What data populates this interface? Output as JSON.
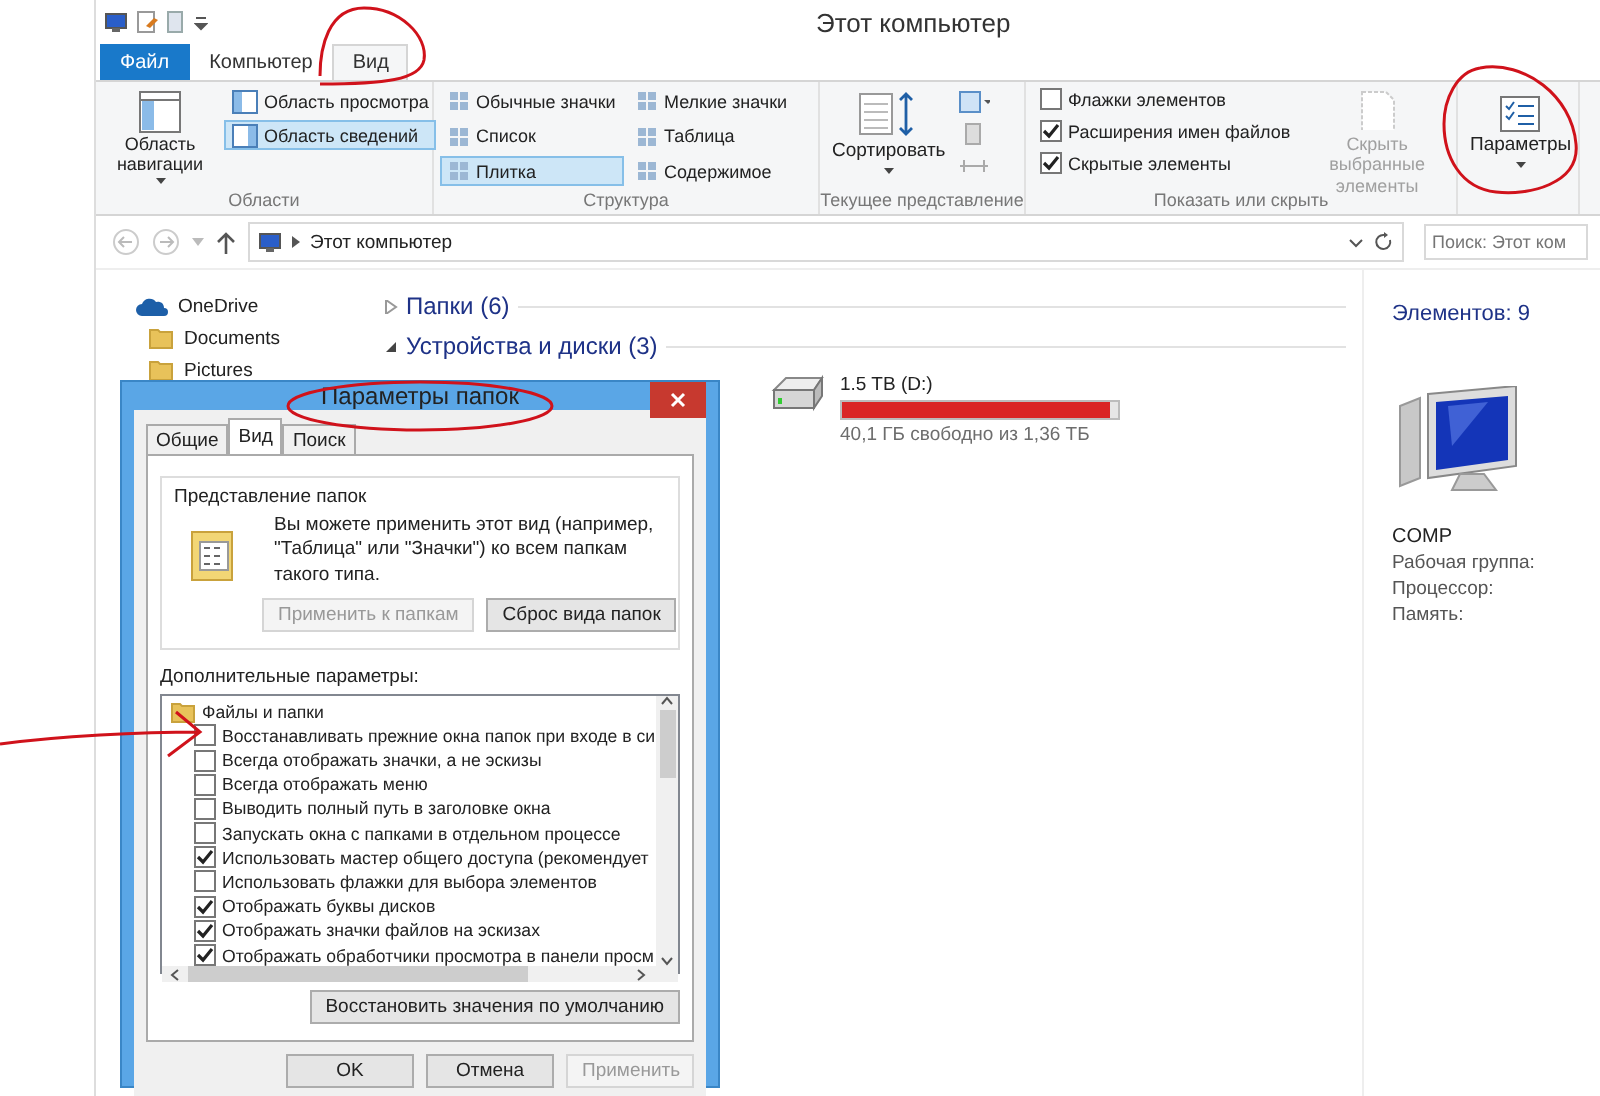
{
  "window": {
    "title": "Этот компьютер"
  },
  "ribbon": {
    "tabs": [
      {
        "label": "Файл",
        "kind": "file",
        "selected": false
      },
      {
        "label": "Компьютер",
        "kind": "tab",
        "selected": false
      },
      {
        "label": "Вид",
        "kind": "tab",
        "selected": true
      }
    ],
    "areas": {
      "label": "Области",
      "nav_pane": "Область навигации",
      "panes": [
        {
          "label": "Область просмотра",
          "selected": false
        },
        {
          "label": "Область сведений",
          "selected": true
        }
      ]
    },
    "layout": {
      "label": "Структура",
      "views": [
        {
          "label": "Обычные значки",
          "selected": false
        },
        {
          "label": "Мелкие значки",
          "selected": false
        },
        {
          "label": "Список",
          "selected": false
        },
        {
          "label": "Таблица",
          "selected": false
        },
        {
          "label": "Плитка",
          "selected": true
        },
        {
          "label": "Содержимое",
          "selected": false
        }
      ]
    },
    "current_view": {
      "label": "Текущее представление",
      "sort": "Сортировать"
    },
    "show_hide": {
      "label": "Показать или скрыть",
      "checkboxes": [
        {
          "label": "Флажки элементов",
          "checked": false
        },
        {
          "label": "Расширения имен файлов",
          "checked": true
        },
        {
          "label": "Скрытые элементы",
          "checked": true
        }
      ],
      "hide_selected": {
        "label": "Скрыть выбранные элементы",
        "disabled": true
      }
    },
    "options": {
      "label": "Параметры"
    }
  },
  "address_bar": {
    "path": "Этот компьютер"
  },
  "search": {
    "placeholder": "Поиск: Этот ком"
  },
  "nav_pane": {
    "items": [
      {
        "label": "OneDrive",
        "kind": "cloud"
      },
      {
        "label": "Documents",
        "kind": "folder"
      },
      {
        "label": "Pictures",
        "kind": "folder"
      }
    ]
  },
  "content": {
    "groups": [
      {
        "label": "Папки (6)",
        "expanded": false
      },
      {
        "label": "Устройства и диски (3)",
        "expanded": true
      }
    ],
    "drives": [
      {
        "name": "1.5 TB (D:)",
        "level": 0.97,
        "free": "40,1 ГБ свободно из 1,36 ТБ"
      }
    ]
  },
  "details": {
    "count": "Элементов: 9",
    "name": "COMP",
    "properties": [
      "Рабочая группа:",
      "Процессор:",
      "Память:"
    ]
  },
  "dialog": {
    "title": "Параметры папок",
    "tabs": [
      {
        "label": "Общие",
        "selected": false
      },
      {
        "label": "Вид",
        "selected": true
      },
      {
        "label": "Поиск",
        "selected": false
      }
    ],
    "folder_views": {
      "legend": "Представление папок",
      "text": "Вы можете применить этот вид (например, \"Таблица\" или \"Значки\") ко всем папкам такого типа.",
      "buttons": [
        {
          "label": "Применить к папкам",
          "disabled": true
        },
        {
          "label": "Сброс вида папок",
          "disabled": false
        }
      ]
    },
    "advanced": {
      "label": "Дополнительные параметры:",
      "tree": [
        {
          "label": "Файлы и папки",
          "children": [
            {
              "label": "Восстанавливать прежние окна папок при входе в си",
              "checked": false
            },
            {
              "label": "Всегда отображать значки, а не эскизы",
              "checked": false
            },
            {
              "label": "Всегда отображать меню",
              "checked": false
            },
            {
              "label": "Выводить полный путь в заголовке окна",
              "checked": false
            },
            {
              "label": "Запускать окна с папками в отдельном процессе",
              "checked": false
            },
            {
              "label": "Использовать мастер общего доступа (рекомендует",
              "checked": true
            },
            {
              "label": "Использовать флажки для выбора элементов",
              "checked": false
            },
            {
              "label": "Отображать буквы дисков",
              "checked": true
            },
            {
              "label": "Отображать значки файлов на эскизах",
              "checked": true
            },
            {
              "label": "Отображать обработчики просмотра в панели просм",
              "checked": true
            }
          ]
        }
      ]
    },
    "restore": "Восстановить значения по умолчанию",
    "buttons": [
      {
        "label": "OK",
        "disabled": false
      },
      {
        "label": "Отмена",
        "disabled": false
      },
      {
        "label": "Применить",
        "disabled": true
      }
    ]
  }
}
